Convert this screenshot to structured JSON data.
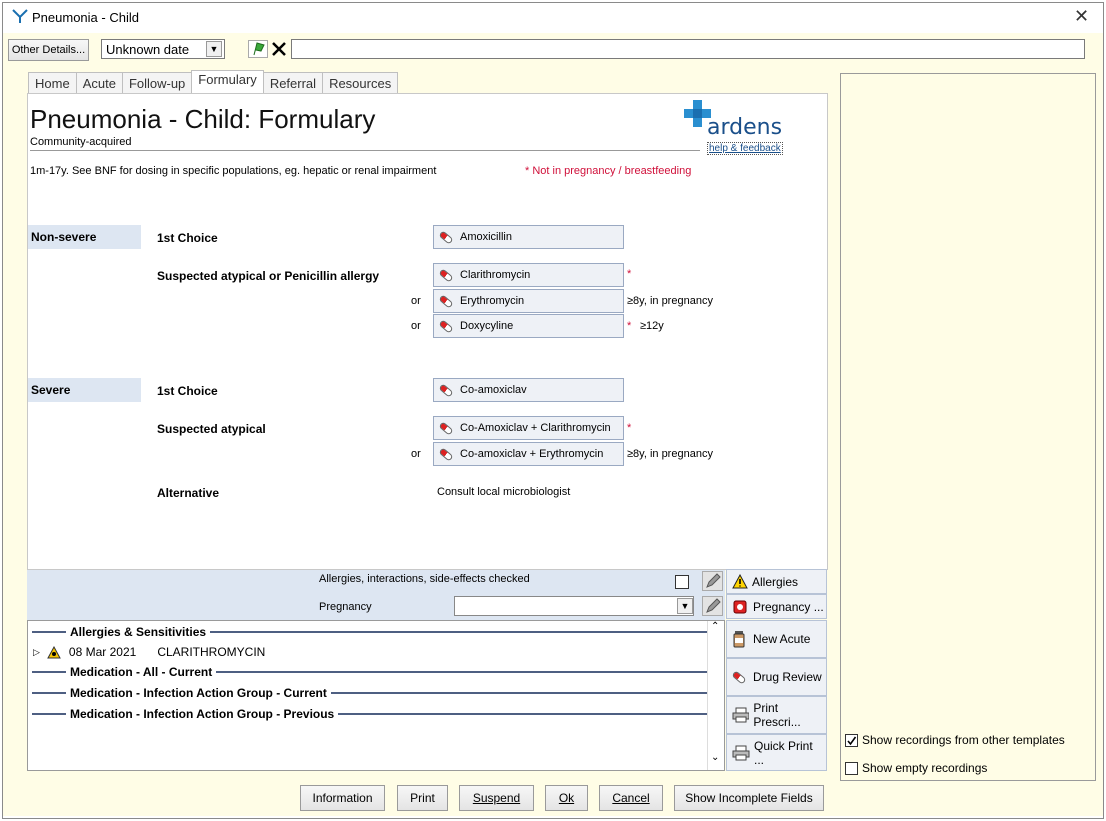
{
  "window": {
    "title": "Pneumonia - Child",
    "close_glyph": "✕"
  },
  "toolbar": {
    "other_details": "Other Details...",
    "date_value": "Unknown date",
    "text_value": ""
  },
  "tabs": [
    "Home",
    "Acute",
    "Follow-up",
    "Formulary",
    "Referral",
    "Resources"
  ],
  "page": {
    "heading": "Pneumonia - Child: Formulary",
    "subheading": "Community-acquired",
    "intro": "1m-17y. See BNF for dosing in specific populations, eg. hepatic or renal impairment",
    "warning": "* Not in pregnancy / breastfeeding",
    "logo_text": "ardens",
    "help_link": "help & feedback"
  },
  "non_severe": {
    "label": "Non-severe",
    "first_choice_label": "1st Choice",
    "first_choice_drug": "Amoxicillin",
    "atypical_label": "Suspected atypical or Penicillin allergy",
    "drug_1": "Clarithromycin",
    "drug_1_note": "*",
    "or_1": "or",
    "drug_2": "Erythromycin",
    "drug_2_note": "≥8y, in pregnancy",
    "or_2": "or",
    "drug_3": "Doxycyline",
    "drug_3_star": "*",
    "drug_3_note": "≥12y"
  },
  "severe": {
    "label": "Severe",
    "first_choice_label": "1st Choice",
    "first_choice_drug": "Co-amoxiclav",
    "atypical_label": "Suspected atypical",
    "drug_1": "Co-Amoxiclav + Clarithromycin",
    "drug_1_note": "*",
    "or_1": "or",
    "drug_2": "Co-amoxiclav + Erythromycin",
    "drug_2_note": "≥8y, in pregnancy",
    "alternative_label": "Alternative",
    "alternative_text": "Consult local microbiologist"
  },
  "checks": {
    "allergies_label": "Allergies, interactions, side-effects checked",
    "pregnancy_label": "Pregnancy",
    "pregnancy_value": ""
  },
  "side_buttons": [
    "Allergies",
    "Pregnancy ...",
    "New Acute",
    "Drug Review",
    "Print Prescri...",
    "Quick Print ..."
  ],
  "recordings": {
    "group_1": "Allergies & Sensitivities",
    "entry_date": "08 Mar 2021",
    "entry_drug": "CLARITHROMYCIN",
    "group_2": "Medication - All - Current",
    "group_3": "Medication - Infection Action Group - Current",
    "group_4": "Medication - Infection Action Group - Previous"
  },
  "right_pane": {
    "show_other": "Show recordings from other templates",
    "show_other_checked": true,
    "show_empty": "Show empty recordings",
    "show_empty_checked": false
  },
  "footer": {
    "information": "Information",
    "print": "Print",
    "suspend": "Suspend",
    "ok": "Ok",
    "cancel": "Cancel",
    "show_incomplete": "Show Incomplete Fields"
  },
  "colors": {
    "brand_blue": "#1a6fb0",
    "warning_red": "#d0103a",
    "panel_yellow": "#fffde6",
    "band_blue": "#dde6f2"
  }
}
